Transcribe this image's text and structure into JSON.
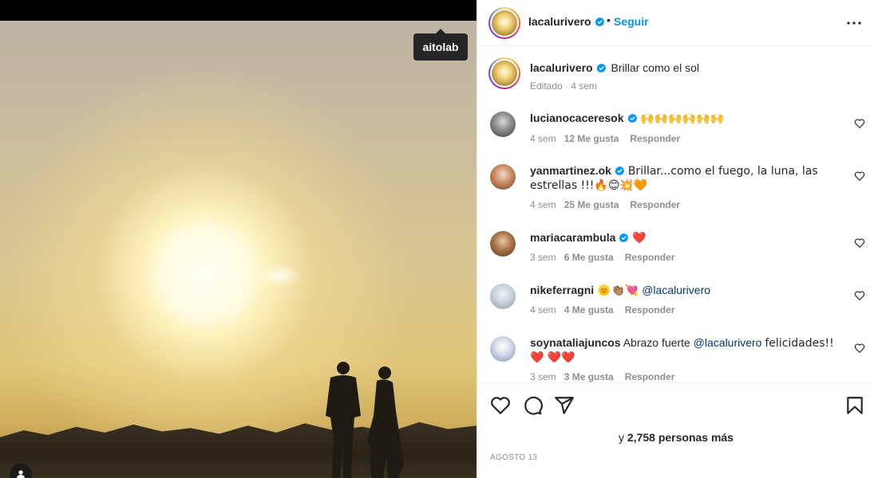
{
  "media": {
    "tooltip_username": "aitolab"
  },
  "post": {
    "author": "lacalurivero",
    "follow_label": "Seguir",
    "dot": "•",
    "caption_text": "Brillar como el sol",
    "caption_meta": "Editado · 4 sem"
  },
  "comments": [
    {
      "username": "lucianocaceresok",
      "verified": true,
      "text": "🙌🙌🙌🙌🙌🙌",
      "time": "4 sem",
      "likes": "12 Me gusta",
      "reply": "Responder"
    },
    {
      "username": "yanmartinez.ok",
      "verified": true,
      "text": "Brillar...como el fuego, la luna, las estrellas !!!🔥😊💥🧡",
      "time": "4 sem",
      "likes": "25 Me gusta",
      "reply": "Responder"
    },
    {
      "username": "mariacarambula",
      "verified": true,
      "text": "❤️",
      "time": "3 sem",
      "likes": "6 Me gusta",
      "reply": "Responder"
    },
    {
      "username": "nikeferragni",
      "verified": false,
      "text": "🌞👏🏽💘",
      "mention": "@lacalurivero",
      "time": "4 sem",
      "likes": "4 Me gusta",
      "reply": "Responder"
    },
    {
      "username": "soynataliajuncos",
      "verified": false,
      "text": "Abrazo fuerte",
      "mention": "@lacalurivero",
      "text_after": "felicidades!!❤️ ❤️❤️",
      "time": "3 sem",
      "likes": "3 Me gusta",
      "reply": "Responder"
    }
  ],
  "footer": {
    "likes_prefix": "y",
    "likes_count": "2,758 personas más",
    "date": "AGOSTO 13"
  },
  "icons": {
    "like": "heart-outline-icon",
    "comment": "comment-bubble-icon",
    "share": "paper-plane-icon",
    "save": "bookmark-icon",
    "more": "more-horizontal-icon",
    "verified": "verified-badge-icon",
    "tag": "user-tag-icon"
  },
  "colors": {
    "accent": "#0095f6",
    "verified": "#0095f6",
    "muted": "#8e8e8e",
    "text": "#262626",
    "mention": "#00376b"
  }
}
